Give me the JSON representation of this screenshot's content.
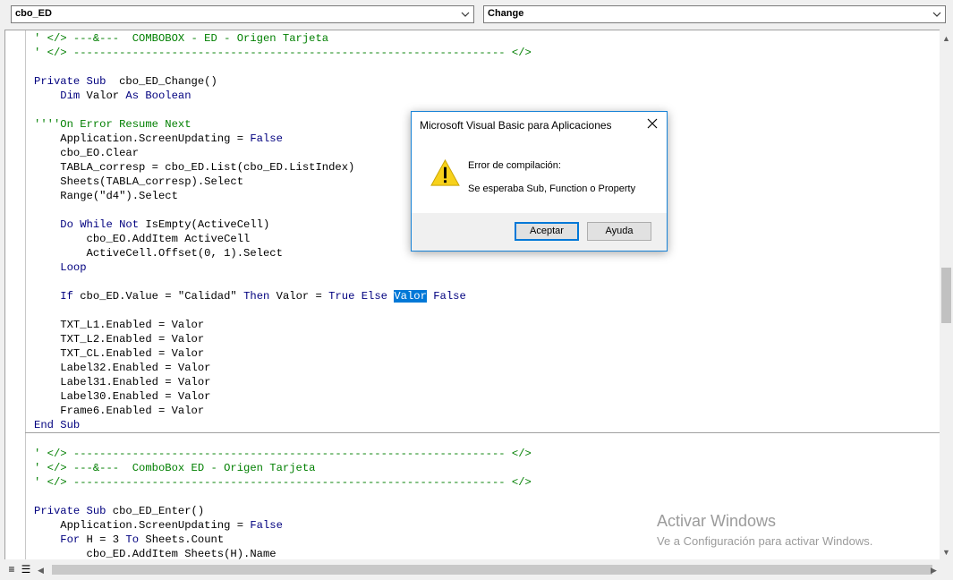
{
  "toolbar": {
    "object_combo": "cbo_ED",
    "procedure_combo": "Change"
  },
  "code_block1": [
    {
      "t": [
        [
          "cm",
          "' </> ---&---  COMBOBOX - ED - Origen Tarjeta"
        ]
      ]
    },
    {
      "t": [
        [
          "cm",
          "' </> ------------------------------------------------------------------ </>"
        ]
      ]
    },
    {
      "t": []
    },
    {
      "t": [
        [
          "kw",
          "Private Sub"
        ],
        [
          "",
          "  cbo_ED_Change()"
        ]
      ]
    },
    {
      "t": [
        [
          "",
          "    "
        ],
        [
          "kw",
          "Dim"
        ],
        [
          "",
          " Valor "
        ],
        [
          "kw",
          "As Boolean"
        ]
      ]
    },
    {
      "t": []
    },
    {
      "t": [
        [
          "cm",
          "''''On Error Resume Next"
        ]
      ]
    },
    {
      "t": [
        [
          "",
          "    Application.ScreenUpdating = "
        ],
        [
          "kw",
          "False"
        ]
      ]
    },
    {
      "t": [
        [
          "",
          "    cbo_EO.Clear"
        ]
      ]
    },
    {
      "t": [
        [
          "",
          "    TABLA_corresp = cbo_ED.List(cbo_ED.ListIndex)"
        ]
      ]
    },
    {
      "t": [
        [
          "",
          "    Sheets(TABLA_corresp).Select"
        ]
      ]
    },
    {
      "t": [
        [
          "",
          "    Range(\"d4\").Select"
        ]
      ]
    },
    {
      "t": []
    },
    {
      "t": [
        [
          "",
          "    "
        ],
        [
          "kw",
          "Do While Not"
        ],
        [
          "",
          " IsEmpty(ActiveCell)"
        ]
      ]
    },
    {
      "t": [
        [
          "",
          "        cbo_EO.AddItem ActiveCell"
        ]
      ]
    },
    {
      "t": [
        [
          "",
          "        ActiveCell.Offset(0, 1).Select"
        ]
      ]
    },
    {
      "t": [
        [
          "",
          "    "
        ],
        [
          "kw",
          "Loop"
        ]
      ]
    },
    {
      "t": []
    },
    {
      "t": [
        [
          "",
          "    "
        ],
        [
          "kw",
          "If"
        ],
        [
          "",
          " cbo_ED.Value = \"Calidad\" "
        ],
        [
          "kw",
          "Then"
        ],
        [
          "",
          " Valor = "
        ],
        [
          "kw",
          "True Else"
        ],
        [
          "",
          " "
        ],
        [
          "sel",
          "Valor"
        ],
        [
          "",
          " "
        ],
        [
          "kw",
          "False"
        ]
      ]
    },
    {
      "t": []
    },
    {
      "t": [
        [
          "",
          "    TXT_L1.Enabled = Valor"
        ]
      ]
    },
    {
      "t": [
        [
          "",
          "    TXT_L2.Enabled = Valor"
        ]
      ]
    },
    {
      "t": [
        [
          "",
          "    TXT_CL.Enabled = Valor"
        ]
      ]
    },
    {
      "t": [
        [
          "",
          "    Label32.Enabled = Valor"
        ]
      ]
    },
    {
      "t": [
        [
          "",
          "    Label31.Enabled = Valor"
        ]
      ]
    },
    {
      "t": [
        [
          "",
          "    Label30.Enabled = Valor"
        ]
      ]
    },
    {
      "t": [
        [
          "",
          "    Frame6.Enabled = Valor"
        ]
      ]
    },
    {
      "t": [
        [
          "kw",
          "End Sub"
        ]
      ]
    }
  ],
  "code_block2": [
    {
      "t": [
        [
          "cm",
          "' </> ------------------------------------------------------------------ </>"
        ]
      ]
    },
    {
      "t": [
        [
          "cm",
          "' </> ---&---  ComboBox ED - Origen Tarjeta"
        ]
      ]
    },
    {
      "t": [
        [
          "cm",
          "' </> ------------------------------------------------------------------ </>"
        ]
      ]
    },
    {
      "t": []
    },
    {
      "t": [
        [
          "kw",
          "Private Sub"
        ],
        [
          "",
          " cbo_ED_Enter()"
        ]
      ]
    },
    {
      "t": [
        [
          "",
          "    Application.ScreenUpdating = "
        ],
        [
          "kw",
          "False"
        ]
      ]
    },
    {
      "t": [
        [
          "",
          "    "
        ],
        [
          "kw",
          "For"
        ],
        [
          "",
          " H = 3 "
        ],
        [
          "kw",
          "To"
        ],
        [
          "",
          " Sheets.Count"
        ]
      ]
    },
    {
      "t": [
        [
          "",
          "        cbo_ED.AddItem Sheets(H).Name"
        ]
      ]
    }
  ],
  "dialog": {
    "title": "Microsoft Visual Basic para Aplicaciones",
    "message_heading": "Error de compilación:",
    "message_detail": "Se esperaba Sub, Function o Property",
    "ok_label": "Aceptar",
    "help_label": "Ayuda"
  },
  "watermark": {
    "line1": "Activar Windows",
    "line2": "Ve a Configuración para activar Windows."
  },
  "colors": {
    "keyword": "#00007f",
    "comment": "#007f00",
    "selection": "#0078d7",
    "warning_icon": "#f7d11b"
  }
}
